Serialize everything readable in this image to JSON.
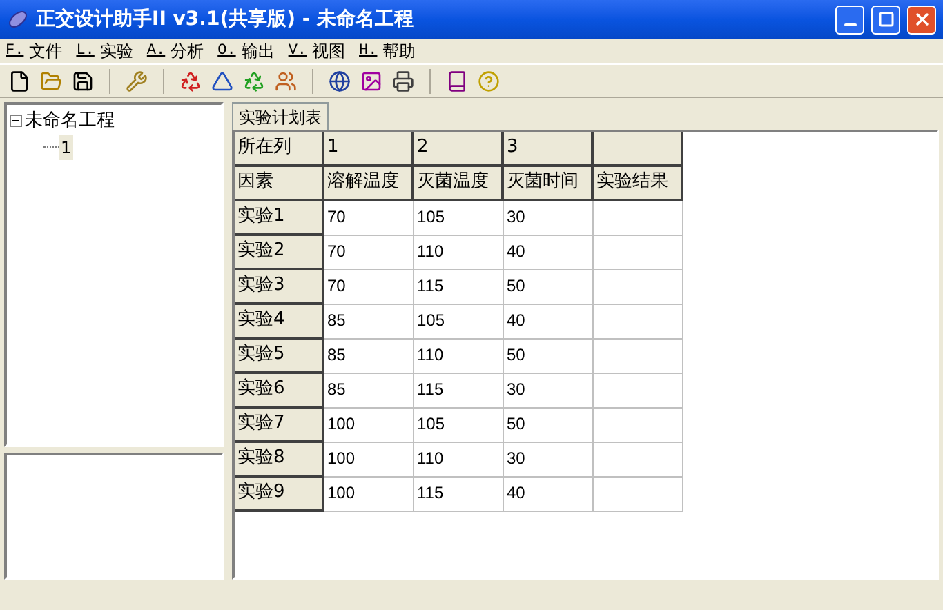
{
  "window": {
    "title": "正交设计助手II v3.1(共享版) - 未命名工程"
  },
  "menu": [
    {
      "key": "F.",
      "label": "文件"
    },
    {
      "key": "L.",
      "label": "实验"
    },
    {
      "key": "A.",
      "label": "分析"
    },
    {
      "key": "O.",
      "label": "输出"
    },
    {
      "key": "V.",
      "label": "视图"
    },
    {
      "key": "H.",
      "label": "帮助"
    }
  ],
  "tree": {
    "label": "未命名工程",
    "expanded": true,
    "children": [
      {
        "label": "1",
        "selected": true
      }
    ]
  },
  "tabs": [
    {
      "label": "实验计划表",
      "selected": true
    }
  ],
  "table": {
    "column_row": {
      "label": "所在列",
      "cells": [
        "1",
        "2",
        "3"
      ]
    },
    "factor_row": {
      "label": "因素",
      "cells": [
        "溶解温度",
        "灭菌温度",
        "灭菌时间",
        "实验结果"
      ]
    },
    "rows": [
      {
        "label": "实验1",
        "values": [
          "70",
          "105",
          "30"
        ]
      },
      {
        "label": "实验2",
        "values": [
          "70",
          "110",
          "40"
        ]
      },
      {
        "label": "实验3",
        "values": [
          "70",
          "115",
          "50"
        ]
      },
      {
        "label": "实验4",
        "values": [
          "85",
          "105",
          "40"
        ]
      },
      {
        "label": "实验5",
        "values": [
          "85",
          "110",
          "50"
        ]
      },
      {
        "label": "实验6",
        "values": [
          "85",
          "115",
          "30"
        ]
      },
      {
        "label": "实验7",
        "values": [
          "100",
          "105",
          "50"
        ]
      },
      {
        "label": "实验8",
        "values": [
          "100",
          "110",
          "30"
        ]
      },
      {
        "label": "实验9",
        "values": [
          "100",
          "115",
          "40"
        ]
      }
    ]
  }
}
